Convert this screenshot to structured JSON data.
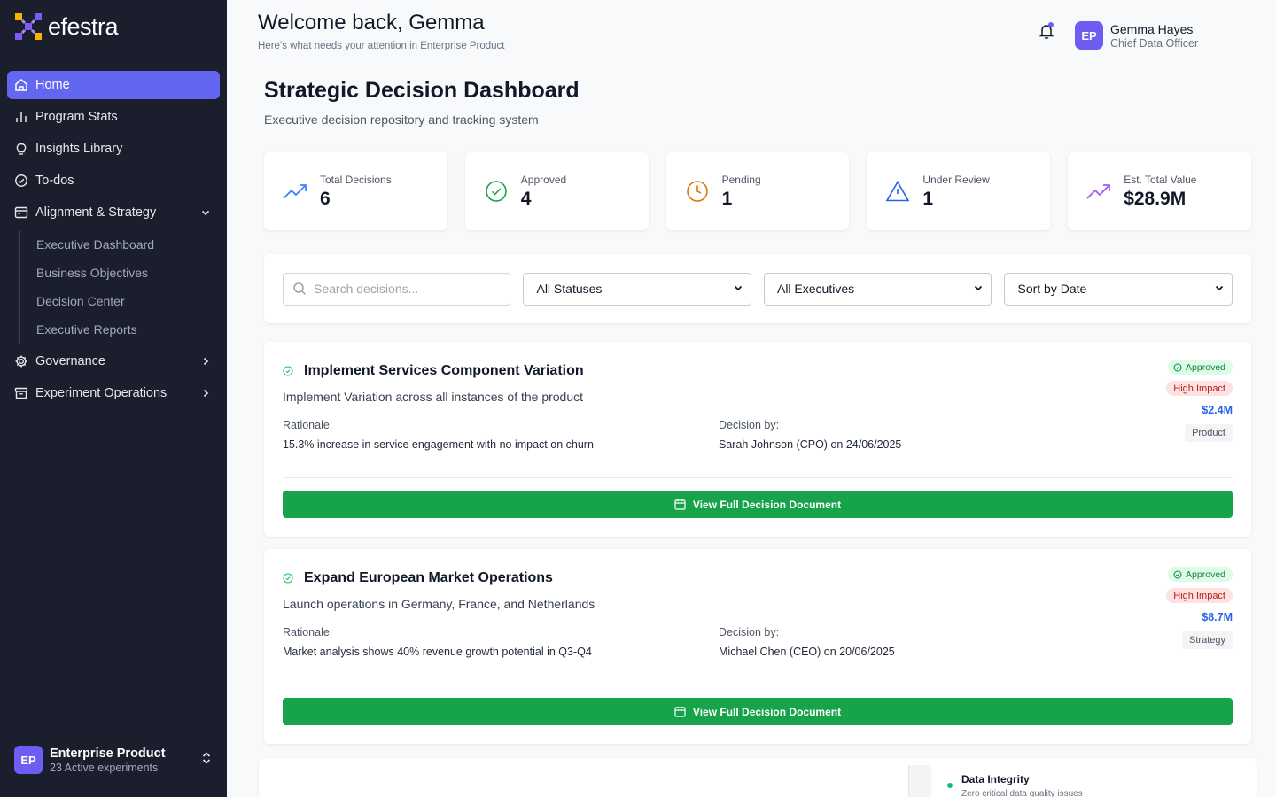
{
  "brand": {
    "name": "efestra",
    "logo_icon": "efestra-logo-icon"
  },
  "sidebar": {
    "items": [
      {
        "label": "Home",
        "icon": "home-icon",
        "active": true
      },
      {
        "label": "Program Stats",
        "icon": "bar-chart-icon"
      },
      {
        "label": "Insights Library",
        "icon": "lightbulb-icon"
      },
      {
        "label": "To-dos",
        "icon": "check-circle-icon"
      },
      {
        "label": "Alignment & Strategy",
        "icon": "calendar-icon",
        "expanded": true,
        "children": [
          "Executive Dashboard",
          "Business Objectives",
          "Decision Center",
          "Executive Reports"
        ]
      },
      {
        "label": "Governance",
        "icon": "gear-icon"
      },
      {
        "label": "Experiment Operations",
        "icon": "archive-icon"
      }
    ],
    "workspace": {
      "initials": "EP",
      "name": "Enterprise Product",
      "subtitle": "23 Active experiments"
    }
  },
  "header": {
    "welcome": "Welcome back, Gemma",
    "subtitle": "Here’s what needs your attention in Enterprise Product",
    "user": {
      "initials": "EP",
      "name": "Gemma Hayes",
      "role": "Chief Data Officer"
    }
  },
  "page": {
    "title": "Strategic Decision Dashboard",
    "subtitle": "Executive decision repository and tracking system"
  },
  "stats": [
    {
      "label": "Total Decisions",
      "value": "6",
      "icon": "trending-up-icon",
      "color": "#3b82f6"
    },
    {
      "label": "Approved",
      "value": "4",
      "icon": "check-circle-icon",
      "color": "#16a34a"
    },
    {
      "label": "Pending",
      "value": "1",
      "icon": "clock-icon",
      "color": "#d97706"
    },
    {
      "label": "Under Review",
      "value": "1",
      "icon": "warning-triangle-icon",
      "color": "#2563eb"
    },
    {
      "label": "Est. Total Value",
      "value": "$28.9M",
      "icon": "trending-up-icon",
      "color": "#a855f7"
    }
  ],
  "filters": {
    "search_placeholder": "Search decisions...",
    "status": "All Statuses",
    "executive": "All Executives",
    "sort": "Sort by Date"
  },
  "decisions": [
    {
      "title": "Implement Services Component Variation",
      "description": "Implement Variation across all instances of the product",
      "rationale_label": "Rationale:",
      "rationale": "15.3% increase in service engagement with no impact on churn",
      "decision_label": "Decision by:",
      "decision_by": "Sarah Johnson (CPO) on 24/06/2025",
      "status": "Approved",
      "impact": "High Impact",
      "value": "$2.4M",
      "category": "Product",
      "button": "View Full Decision Document"
    },
    {
      "title": "Expand European Market Operations",
      "description": "Launch operations in Germany, France, and Netherlands",
      "rationale_label": "Rationale:",
      "rationale": "Market analysis shows 40% revenue growth potential in Q3-Q4",
      "decision_label": "Decision by:",
      "decision_by": "Michael Chen (CEO) on 20/06/2025",
      "status": "Approved",
      "impact": "High Impact",
      "value": "$8.7M",
      "category": "Strategy",
      "button": "View Full Decision Document"
    }
  ],
  "bottom_card": {
    "title": "Data Integrity",
    "subtitle": "Zero critical data quality issues"
  },
  "colors": {
    "sidebar_bg": "#1b1f2d",
    "accent": "#6366f1",
    "success": "#16a34a",
    "value_blue": "#2563eb"
  }
}
